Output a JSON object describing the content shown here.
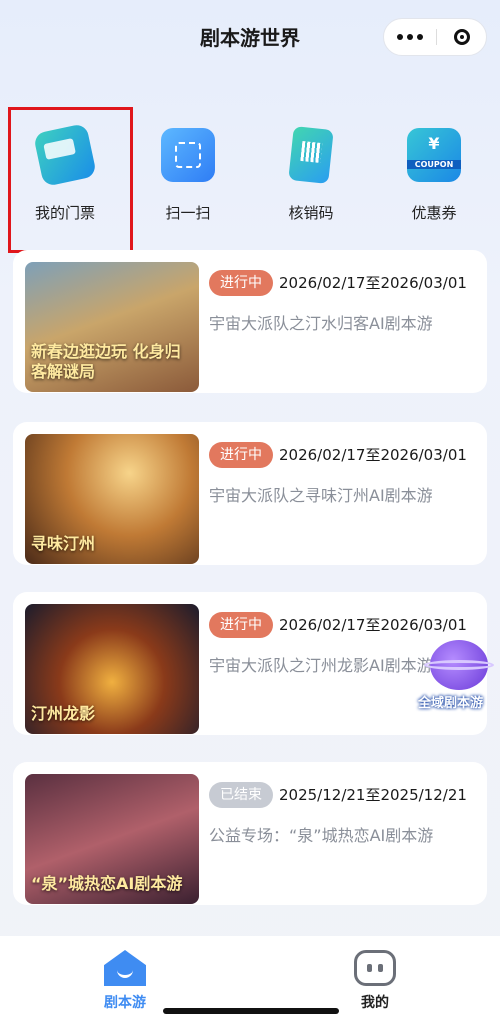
{
  "header": {
    "title": "剧本游世界"
  },
  "quick_actions": [
    {
      "label": "我的门票",
      "icon": "ticket-icon"
    },
    {
      "label": "扫一扫",
      "icon": "scan-icon"
    },
    {
      "label": "核销码",
      "icon": "qr-code-icon"
    },
    {
      "label": "优惠券",
      "icon": "coupon-icon",
      "icon_text": "COUPON",
      "symbol": "¥"
    }
  ],
  "cards": [
    {
      "status": "进行中",
      "dates": "2026/02/17至2026/03/01",
      "title": "宇宙大派队之汀水归客AI剧本游",
      "thumb_text": "新春边逛边玩 化身归客解谜局"
    },
    {
      "status": "进行中",
      "dates": "2026/02/17至2026/03/01",
      "title": "宇宙大派队之寻味汀州AI剧本游",
      "thumb_text": "寻味汀州"
    },
    {
      "status": "进行中",
      "dates": "2026/02/17至2026/03/01",
      "title": "宇宙大派队之汀州龙影AI剧本游",
      "thumb_text": "汀州龙影"
    },
    {
      "status": "已结束",
      "dates": "2025/12/21至2025/12/21",
      "title": "公益专场：“泉”城热恋AI剧本游",
      "thumb_text": "“泉”城热恋AI剧本游"
    }
  ],
  "floating": {
    "label": "全域剧本游"
  },
  "tabbar": {
    "items": [
      {
        "label": "剧本游",
        "active": true,
        "color": "#3f8cf2"
      },
      {
        "label": "我的",
        "active": false,
        "color": "#222222"
      }
    ]
  },
  "colors": {
    "active_badge": "#e2785e",
    "ended_badge": "#c7cbd3",
    "highlight": "#e0161b"
  }
}
